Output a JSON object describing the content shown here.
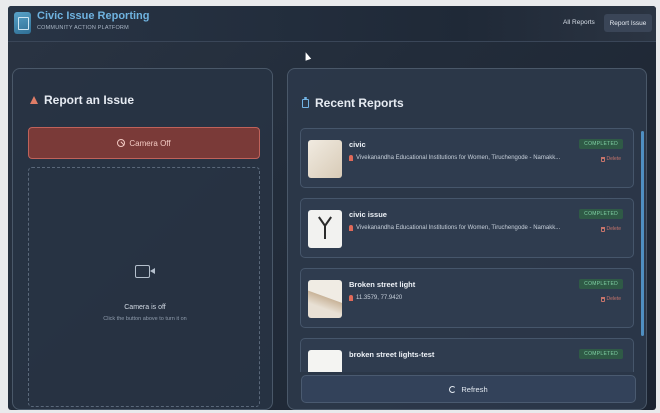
{
  "header": {
    "title": "Civic Issue Reporting",
    "subtitle": "COMMUNITY ACTION PLATFORM",
    "nav": {
      "all_reports": "All Reports",
      "report_issue": "Report Issue"
    }
  },
  "report_panel": {
    "title": "Report an Issue",
    "camera_button": "Camera Off",
    "camera_status": "Camera is off",
    "camera_hint": "Click the button above to turn it on"
  },
  "recent_panel": {
    "title": "Recent Reports",
    "delete_label": "Delete",
    "refresh_label": "Refresh",
    "reports": [
      {
        "title": "civic",
        "location": "Vivekanandha Educational Institutions for Women, Tiruchengode - Namakk...",
        "status": "COMPLETED"
      },
      {
        "title": "civic issue",
        "location": "Vivekanandha Educational Institutions for Women, Tiruchengode - Namakk...",
        "status": "COMPLETED"
      },
      {
        "title": "Broken street light",
        "location": "11.3579, 77.9420",
        "status": "COMPLETED"
      },
      {
        "title": "broken street lights-test",
        "location": "",
        "status": "COMPLETED"
      }
    ]
  },
  "colors": {
    "accent": "#6fb3e0",
    "danger": "#c0625a",
    "success": "#7fd1a4"
  }
}
